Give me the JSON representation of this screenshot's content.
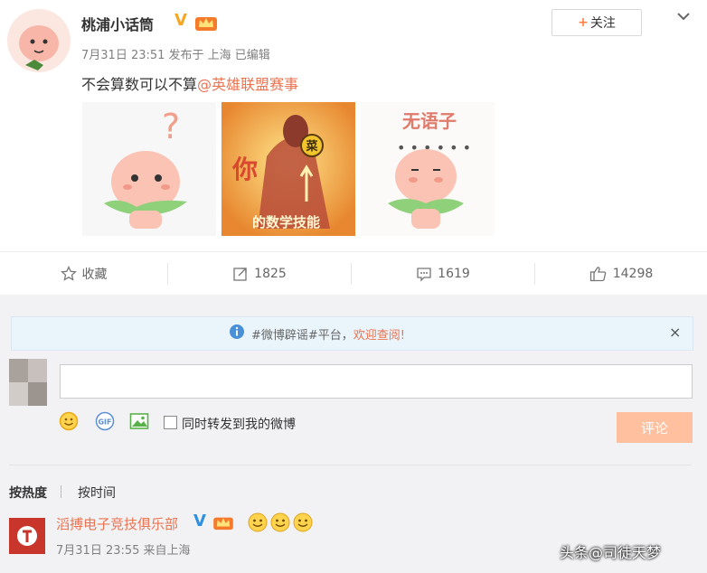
{
  "post": {
    "username": "桃浦小话筒",
    "verified_mark": "V",
    "meta": "7月31日 23:51 发布于 上海  已编辑",
    "text_plain": "不会算数可以不算",
    "text_mention": "@英雄联盟赛事",
    "follow_label": "关注",
    "follow_plus": "+",
    "images": [
      {
        "caption": ""
      },
      {
        "caption_top": "你",
        "badge": "菜",
        "caption": "的数学技能"
      },
      {
        "caption": "无语子"
      }
    ]
  },
  "actions": {
    "favorite": "收藏",
    "repost_count": "1825",
    "comment_count": "1619",
    "like_count": "14298"
  },
  "notice": {
    "prefix": "#微博辟谣#平台，",
    "link": "欢迎查阅!",
    "close": "×"
  },
  "composer": {
    "placeholder": "",
    "sync_label": "同时转发到我的微博",
    "submit_label": "评论"
  },
  "sort": {
    "hot": "按热度",
    "time": "按时间"
  },
  "comment": {
    "username": "滔搏电子竞技俱乐部",
    "verified_mark": "V",
    "meta": "7月31日 23:55 来自上海",
    "emoji_count": 3
  },
  "watermark": "头条@司徒天梦",
  "colors": {
    "accent": "#eb7350",
    "verified_gold": "#f5a623",
    "verified_blue": "#2f8fe0",
    "submit_disabled": "#ffc09f"
  }
}
